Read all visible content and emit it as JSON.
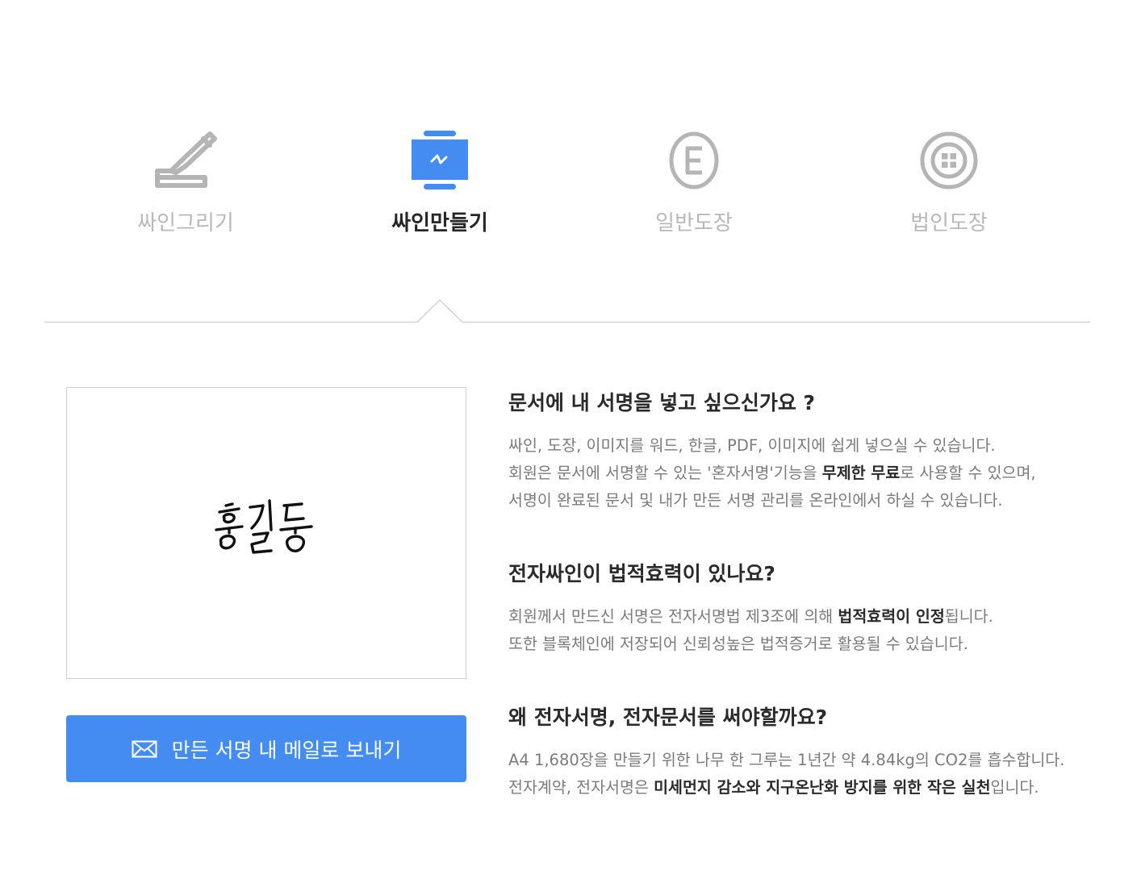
{
  "tabs": [
    {
      "label": "싸인그리기",
      "icon": "pen-sign-icon",
      "active": false
    },
    {
      "label": "싸인만들기",
      "icon": "monitor-sign-icon",
      "active": true
    },
    {
      "label": "일반도장",
      "icon": "round-stamp-icon",
      "active": false
    },
    {
      "label": "법인도장",
      "icon": "corporate-stamp-icon",
      "active": false
    }
  ],
  "preview": {
    "signature_name": "홍길동"
  },
  "send_button": {
    "label": "만든 서명 내 메일로 보내기",
    "icon": "mail-icon"
  },
  "sections": [
    {
      "question": "문서에 내 서명을 넣고 싶으신가요 ?",
      "lines": [
        {
          "parts": [
            {
              "text": "싸인, 도장, 이미지를 워드, 한글, PDF, 이미지에 쉽게 넣으실 수 있습니다."
            }
          ]
        },
        {
          "parts": [
            {
              "text": "회원은 문서에 서명할 수 있는 '혼자서명'기능을 "
            },
            {
              "text": "무제한 무료"
            },
            {
              "text": "로 사용할 수 있으며,"
            }
          ]
        },
        {
          "parts": [
            {
              "text": "서명이 완료된 문서 및 내가 만든 서명 관리를 온라인에서 하실 수 있습니다."
            }
          ]
        }
      ]
    },
    {
      "question": "전자싸인이 법적효력이 있나요?",
      "lines": [
        {
          "parts": [
            {
              "text": "회원께서 만드신 서명은 전자서명법 제3조에 의해 "
            },
            {
              "text": "법적효력이 인정"
            },
            {
              "text": "됩니다."
            }
          ]
        },
        {
          "parts": [
            {
              "text": "또한 블록체인에 저장되어 신뢰성높은 법적증거로 활용될 수 있습니다."
            }
          ]
        }
      ]
    },
    {
      "question": "왜 전자서명, 전자문서를 써야할까요?",
      "lines": [
        {
          "parts": [
            {
              "text": "A4 1,680장을 만들기 위한 나무 한 그루는 1년간 약 4.84kg의 CO2를 흡수합니다."
            }
          ]
        },
        {
          "parts": [
            {
              "text": "전자계약, 전자서명은 "
            },
            {
              "text": "미세먼지 감소와 지구온난화 방지를 위한 작은 실천"
            },
            {
              "text": "입니다."
            }
          ]
        }
      ]
    }
  ],
  "colors": {
    "accent": "#448cf2",
    "inactive": "#b8b8b8",
    "text_dark": "#2a2a2a",
    "text_body": "#7b7b7b"
  }
}
